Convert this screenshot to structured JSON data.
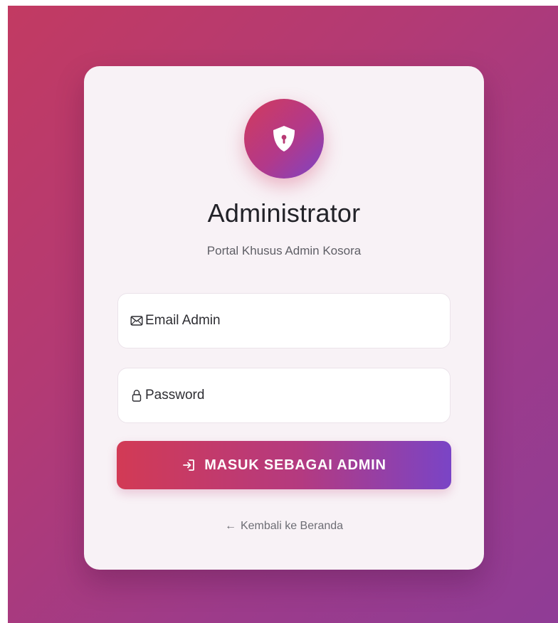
{
  "theme": {
    "background_gradient": [
      "#c23a62",
      "#8f3c96"
    ],
    "card_background": "#f8f2f6",
    "accent_gradient": [
      "#d23a55",
      "#7a44c6"
    ]
  },
  "logo": {
    "icon": "shield-keyhole-icon"
  },
  "header": {
    "title": "Administrator",
    "subtitle": "Portal Khusus Admin Kosora"
  },
  "form": {
    "email": {
      "icon": "envelope-icon",
      "placeholder": "Email Admin",
      "value": ""
    },
    "password": {
      "icon": "lock-icon",
      "placeholder": "Password",
      "value": ""
    },
    "submit": {
      "icon": "sign-in-icon",
      "label": "MASUK SEBAGAI ADMIN"
    }
  },
  "footer": {
    "back_arrow": "←",
    "back_label": "Kembali ke Beranda"
  }
}
